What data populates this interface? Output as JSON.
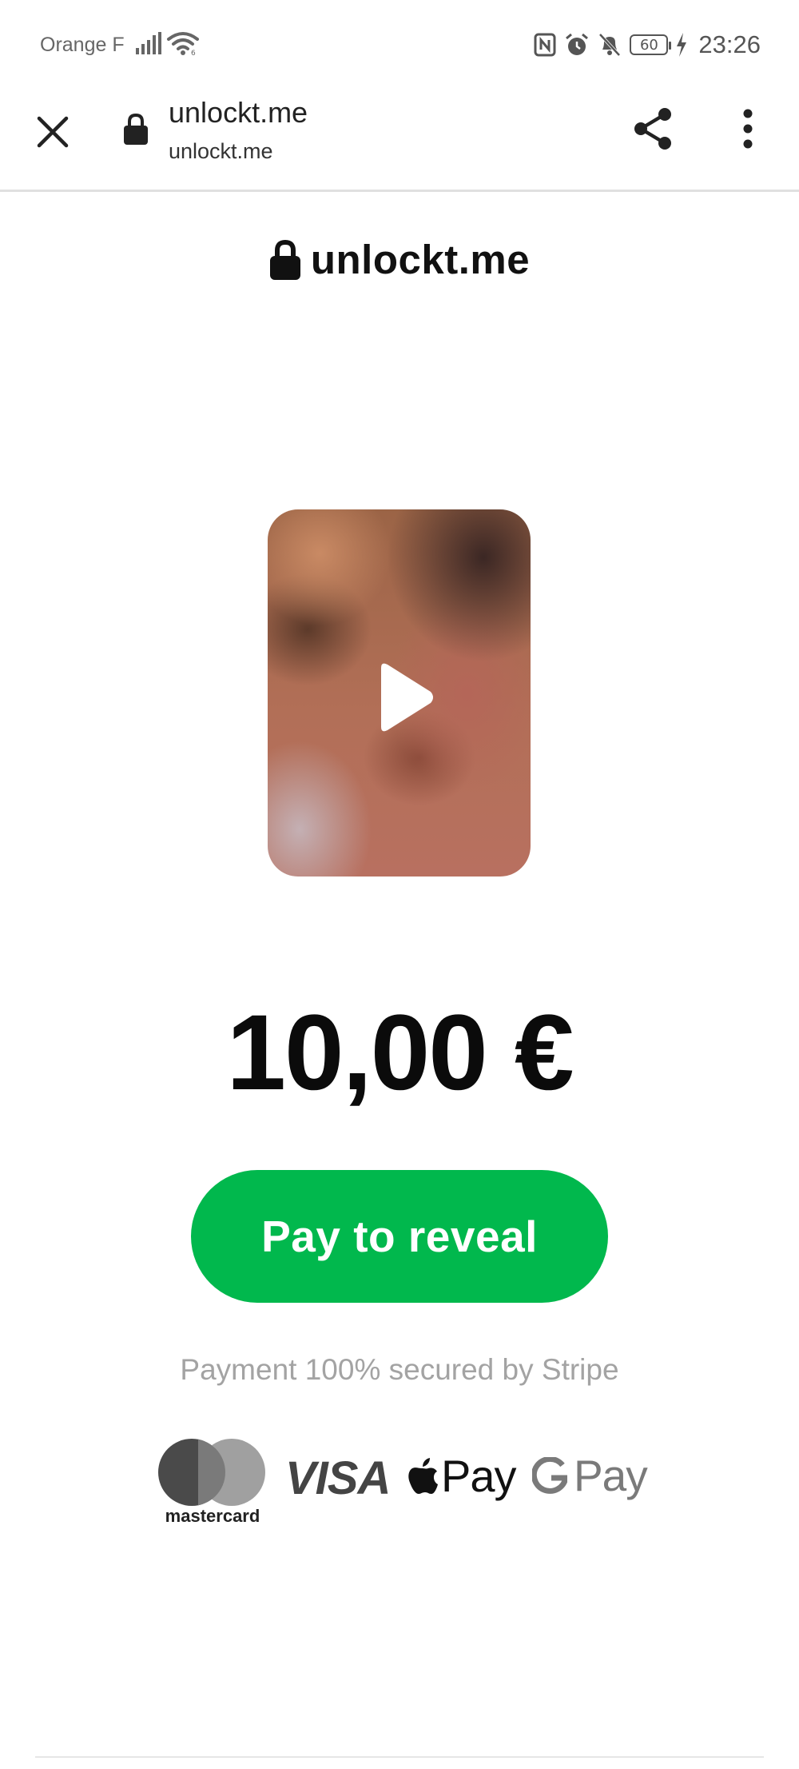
{
  "status_bar": {
    "carrier": "Orange F",
    "time": "23:26",
    "battery": "60"
  },
  "browser": {
    "page_title": "unlockt.me",
    "url": "unlockt.me"
  },
  "page": {
    "brand": "unlockt.me",
    "price": "10,00 €",
    "pay_button": "Pay to reveal",
    "secure_note": "Payment 100% secured by Stripe",
    "payment_methods": {
      "mastercard": "mastercard",
      "visa": "VISA",
      "apple_pay": "Pay",
      "google_pay": "Pay"
    }
  },
  "colors": {
    "accent_green": "#01b84d",
    "muted_text": "#a3a3a3"
  },
  "icons": [
    "close-icon",
    "lock-icon",
    "share-icon",
    "more-vert-icon",
    "play-icon",
    "apple-logo",
    "google-g-logo"
  ]
}
